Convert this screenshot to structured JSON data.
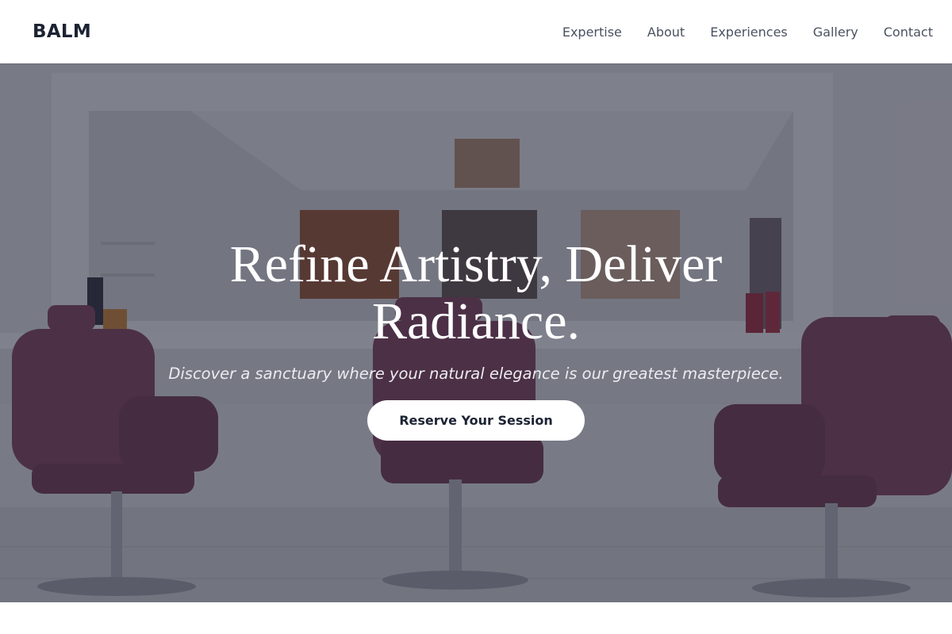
{
  "header": {
    "brand": "BALM",
    "nav": [
      {
        "label": "Expertise"
      },
      {
        "label": "About"
      },
      {
        "label": "Experiences"
      },
      {
        "label": "Gallery"
      },
      {
        "label": "Contact"
      }
    ]
  },
  "hero": {
    "title": "Refine Artistry, Deliver Radiance.",
    "subtitle": "Discover a sanctuary where your natural elegance is our greatest masterpiece.",
    "cta_label": "Reserve Your Session",
    "background_photo": "salon-interior-with-chairs-and-mirror",
    "overlay_color": "#14182c",
    "chair_color": "#8a4a63"
  }
}
